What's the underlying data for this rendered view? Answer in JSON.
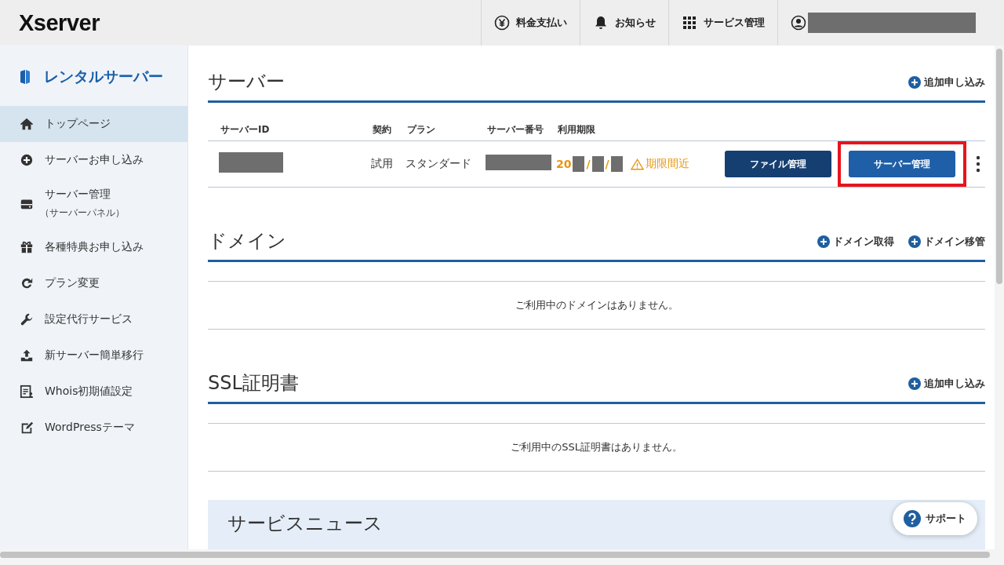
{
  "header": {
    "logo": "Xserver",
    "nav": [
      {
        "kind": "yen",
        "label": "料金支払い"
      },
      {
        "kind": "bell",
        "label": "お知らせ"
      },
      {
        "kind": "grid",
        "label": "サービス管理"
      },
      {
        "kind": "user"
      }
    ]
  },
  "sidebar": {
    "title": "レンタルサーバー",
    "items": [
      {
        "label": "トップページ",
        "selected": true
      },
      {
        "label": "サーバーお申し込み",
        "selected": false
      },
      {
        "label": "サーバー管理",
        "sub": "（サーバーパネル）",
        "selected": false
      },
      {
        "label": "各種特典お申し込み",
        "selected": false
      },
      {
        "label": "プラン変更",
        "selected": false
      },
      {
        "label": "設定代行サービス",
        "selected": false
      },
      {
        "label": "新サーバー簡単移行",
        "selected": false
      },
      {
        "label": "Whois初期値設定",
        "selected": false
      },
      {
        "label": "WordPressテーマ",
        "selected": false
      }
    ]
  },
  "server": {
    "title": "サーバー",
    "actions": [
      "追加申し込み"
    ],
    "columns": [
      "サーバーID",
      "契約",
      "プラン",
      "サーバー番号",
      "利用期限"
    ],
    "row": {
      "contract": "試用",
      "plan": "スタンダード",
      "expiry_prefix": "20",
      "expiry_separators": [
        "/",
        "/"
      ],
      "warning": "期限間近",
      "buttons": [
        {
          "label": "ファイル管理",
          "highlighted": false
        },
        {
          "label": "サーバー管理",
          "highlighted": true
        }
      ]
    }
  },
  "domain": {
    "title": "ドメイン",
    "actions": [
      "ドメイン取得",
      "ドメイン移管"
    ],
    "empty": "ご利用中のドメインはありません。"
  },
  "ssl": {
    "title": "SSL証明書",
    "actions": [
      "追加申し込み"
    ],
    "empty": "ご利用中のSSL証明書はありません。"
  },
  "news": {
    "title": "サービスニュース"
  },
  "support": {
    "label": "サポート"
  }
}
